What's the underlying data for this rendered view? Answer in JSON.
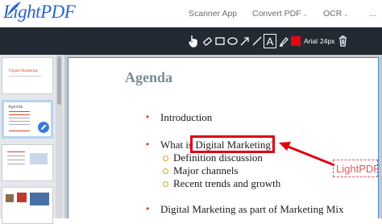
{
  "brand": {
    "logo_text": "LightPDF"
  },
  "nav": {
    "items": [
      {
        "label": "Scanner App",
        "has_menu": false
      },
      {
        "label": "Convert PDF",
        "has_menu": true
      },
      {
        "label": "OCR",
        "has_menu": true
      }
    ]
  },
  "toolbar": {
    "font_name": "Arial",
    "font_size": "24px",
    "text_tool_glyph": "A",
    "color": "#e30613",
    "tools": [
      "hand-pointer-icon",
      "eraser-icon",
      "rectangle-icon",
      "ellipse-icon",
      "arrow-icon",
      "line-icon",
      "text-icon",
      "highlighter-icon",
      "color-swatch",
      "trash-icon"
    ]
  },
  "sidebar": {
    "thumbnails": [
      {
        "title": "Digital Marketing",
        "active": false
      },
      {
        "title": "Agenda",
        "active": true
      },
      {
        "title": "",
        "active": false
      },
      {
        "title": "",
        "active": false
      }
    ]
  },
  "document": {
    "title": "Agenda",
    "bullets": [
      {
        "text": "Introduction",
        "level": 1
      },
      {
        "text": "What is Digital Marketing?",
        "level": 1
      },
      {
        "text": "Definition discussion",
        "level": 2
      },
      {
        "text": "Major channels",
        "level": 2
      },
      {
        "text": "Recent trends and growth",
        "level": 2
      },
      {
        "text": "Digital Marketing as part of Marketing Mix",
        "level": 1
      }
    ],
    "annotation_text": "LightPDF"
  },
  "colors": {
    "accent": "#e00014",
    "toolbar_bg": "#222a33",
    "title": "#7a8c92"
  }
}
